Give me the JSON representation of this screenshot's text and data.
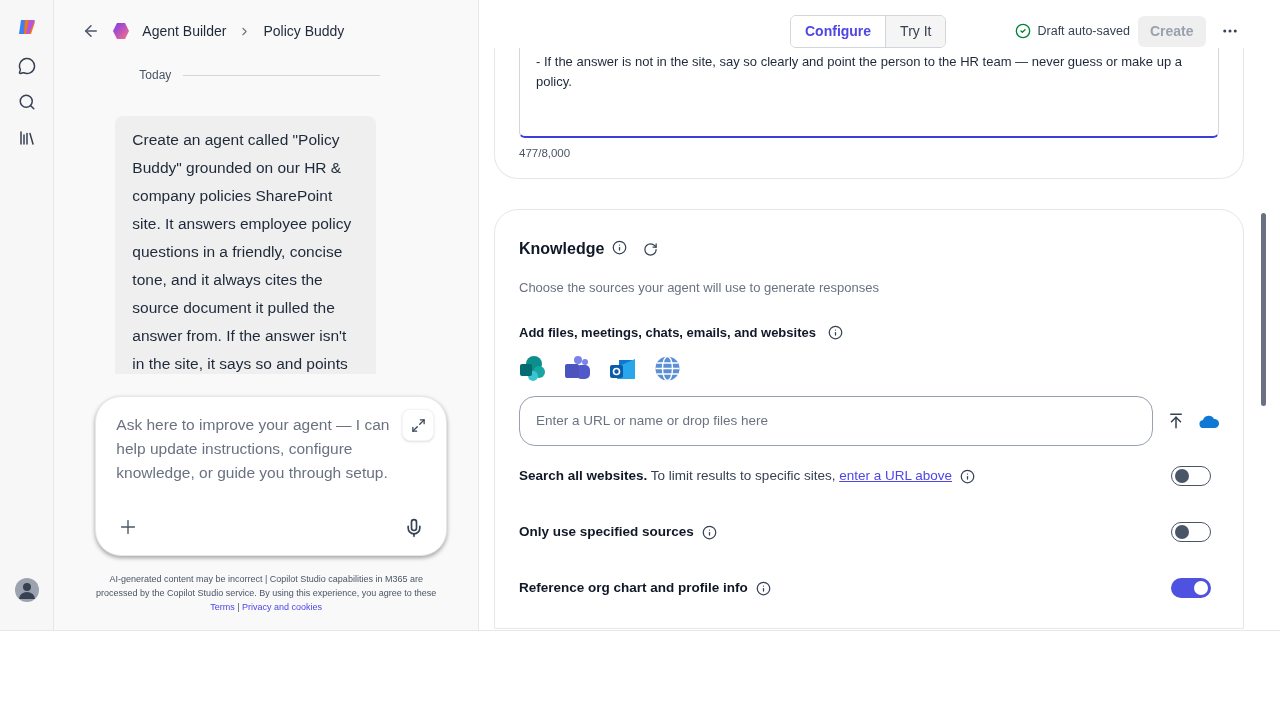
{
  "breadcrumb": {
    "parent": "Agent Builder",
    "current": "Policy Buddy"
  },
  "chat": {
    "date_label": "Today",
    "message": "Create an agent called \"Policy Buddy\" grounded on our HR & company policies SharePoint site. It answers employee policy questions in a friendly, concise tone, and it always cites the source document it pulled the answer from. If the answer isn't in the site, it says so and points",
    "input_placeholder": "Ask here to improve your agent — I can help update instructions, configure knowledge, or guide you through setup.",
    "disclaimer": "AI-generated content may be incorrect | Copilot Studio capabilities in M365 are processed by the Copilot Studio service. By using this experience, you agree to these",
    "terms_link": "Terms",
    "separator": "|",
    "privacy_link": "Privacy and cookies"
  },
  "tabs": [
    {
      "label": "Configure",
      "selected": true
    },
    {
      "label": "Try It",
      "selected": false
    }
  ],
  "save_status": "Draft auto-saved",
  "create_button": {
    "label": "Create",
    "disabled": true
  },
  "instructions": {
    "text": "- If the answer is not in the site, say so clearly and point the person to the HR team — never guess or make up a policy.",
    "counter": "477/8,000"
  },
  "knowledge": {
    "title": "Knowledge",
    "description": "Choose the sources your agent will use to generate responses",
    "add_label": "Add files, meetings, chats, emails, and websites",
    "url_placeholder": "Enter a URL or name or drop files here",
    "options": [
      {
        "label": "Search all websites.",
        "hint": "To limit results to specific sites,",
        "link": "enter a URL above",
        "on": false
      },
      {
        "label": "Only use specified sources",
        "on": false
      },
      {
        "label": "Reference org chart and profile info",
        "on": true
      }
    ]
  }
}
